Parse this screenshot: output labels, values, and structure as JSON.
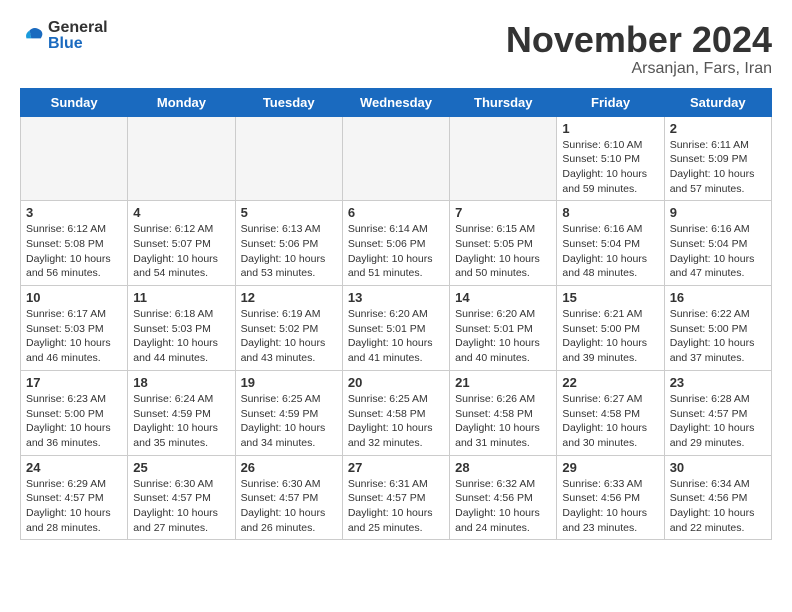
{
  "header": {
    "logo_general": "General",
    "logo_blue": "Blue",
    "month_title": "November 2024",
    "location": "Arsanjan, Fars, Iran"
  },
  "days_of_week": [
    "Sunday",
    "Monday",
    "Tuesday",
    "Wednesday",
    "Thursday",
    "Friday",
    "Saturday"
  ],
  "weeks": [
    [
      {
        "day": "",
        "info": ""
      },
      {
        "day": "",
        "info": ""
      },
      {
        "day": "",
        "info": ""
      },
      {
        "day": "",
        "info": ""
      },
      {
        "day": "",
        "info": ""
      },
      {
        "day": "1",
        "info": "Sunrise: 6:10 AM\nSunset: 5:10 PM\nDaylight: 10 hours and 59 minutes."
      },
      {
        "day": "2",
        "info": "Sunrise: 6:11 AM\nSunset: 5:09 PM\nDaylight: 10 hours and 57 minutes."
      }
    ],
    [
      {
        "day": "3",
        "info": "Sunrise: 6:12 AM\nSunset: 5:08 PM\nDaylight: 10 hours and 56 minutes."
      },
      {
        "day": "4",
        "info": "Sunrise: 6:12 AM\nSunset: 5:07 PM\nDaylight: 10 hours and 54 minutes."
      },
      {
        "day": "5",
        "info": "Sunrise: 6:13 AM\nSunset: 5:06 PM\nDaylight: 10 hours and 53 minutes."
      },
      {
        "day": "6",
        "info": "Sunrise: 6:14 AM\nSunset: 5:06 PM\nDaylight: 10 hours and 51 minutes."
      },
      {
        "day": "7",
        "info": "Sunrise: 6:15 AM\nSunset: 5:05 PM\nDaylight: 10 hours and 50 minutes."
      },
      {
        "day": "8",
        "info": "Sunrise: 6:16 AM\nSunset: 5:04 PM\nDaylight: 10 hours and 48 minutes."
      },
      {
        "day": "9",
        "info": "Sunrise: 6:16 AM\nSunset: 5:04 PM\nDaylight: 10 hours and 47 minutes."
      }
    ],
    [
      {
        "day": "10",
        "info": "Sunrise: 6:17 AM\nSunset: 5:03 PM\nDaylight: 10 hours and 46 minutes."
      },
      {
        "day": "11",
        "info": "Sunrise: 6:18 AM\nSunset: 5:03 PM\nDaylight: 10 hours and 44 minutes."
      },
      {
        "day": "12",
        "info": "Sunrise: 6:19 AM\nSunset: 5:02 PM\nDaylight: 10 hours and 43 minutes."
      },
      {
        "day": "13",
        "info": "Sunrise: 6:20 AM\nSunset: 5:01 PM\nDaylight: 10 hours and 41 minutes."
      },
      {
        "day": "14",
        "info": "Sunrise: 6:20 AM\nSunset: 5:01 PM\nDaylight: 10 hours and 40 minutes."
      },
      {
        "day": "15",
        "info": "Sunrise: 6:21 AM\nSunset: 5:00 PM\nDaylight: 10 hours and 39 minutes."
      },
      {
        "day": "16",
        "info": "Sunrise: 6:22 AM\nSunset: 5:00 PM\nDaylight: 10 hours and 37 minutes."
      }
    ],
    [
      {
        "day": "17",
        "info": "Sunrise: 6:23 AM\nSunset: 5:00 PM\nDaylight: 10 hours and 36 minutes."
      },
      {
        "day": "18",
        "info": "Sunrise: 6:24 AM\nSunset: 4:59 PM\nDaylight: 10 hours and 35 minutes."
      },
      {
        "day": "19",
        "info": "Sunrise: 6:25 AM\nSunset: 4:59 PM\nDaylight: 10 hours and 34 minutes."
      },
      {
        "day": "20",
        "info": "Sunrise: 6:25 AM\nSunset: 4:58 PM\nDaylight: 10 hours and 32 minutes."
      },
      {
        "day": "21",
        "info": "Sunrise: 6:26 AM\nSunset: 4:58 PM\nDaylight: 10 hours and 31 minutes."
      },
      {
        "day": "22",
        "info": "Sunrise: 6:27 AM\nSunset: 4:58 PM\nDaylight: 10 hours and 30 minutes."
      },
      {
        "day": "23",
        "info": "Sunrise: 6:28 AM\nSunset: 4:57 PM\nDaylight: 10 hours and 29 minutes."
      }
    ],
    [
      {
        "day": "24",
        "info": "Sunrise: 6:29 AM\nSunset: 4:57 PM\nDaylight: 10 hours and 28 minutes."
      },
      {
        "day": "25",
        "info": "Sunrise: 6:30 AM\nSunset: 4:57 PM\nDaylight: 10 hours and 27 minutes."
      },
      {
        "day": "26",
        "info": "Sunrise: 6:30 AM\nSunset: 4:57 PM\nDaylight: 10 hours and 26 minutes."
      },
      {
        "day": "27",
        "info": "Sunrise: 6:31 AM\nSunset: 4:57 PM\nDaylight: 10 hours and 25 minutes."
      },
      {
        "day": "28",
        "info": "Sunrise: 6:32 AM\nSunset: 4:56 PM\nDaylight: 10 hours and 24 minutes."
      },
      {
        "day": "29",
        "info": "Sunrise: 6:33 AM\nSunset: 4:56 PM\nDaylight: 10 hours and 23 minutes."
      },
      {
        "day": "30",
        "info": "Sunrise: 6:34 AM\nSunset: 4:56 PM\nDaylight: 10 hours and 22 minutes."
      }
    ]
  ]
}
